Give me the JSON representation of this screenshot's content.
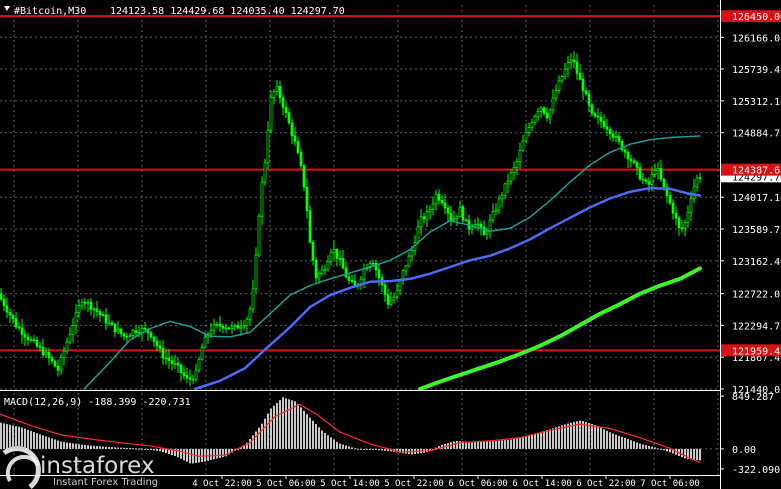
{
  "header": {
    "symbol_label": "#Bitcoin,M30",
    "ohlc_label": "124123.58 124429.68 124035.40 124297.70"
  },
  "colors": {
    "background": "#000000",
    "grid": "#5a5f66",
    "candle": "#00ff00",
    "ma_fast": "#1a9e96",
    "ma_mid": "#4a6cf7",
    "ma_slow": "#3df52a",
    "level_line": "#e01010",
    "level_badge": "#d41414",
    "macd_bars": "#c8c8c8",
    "macd_signal": "#ff2a2a",
    "axis_text": "#ffffff",
    "price_tag_bg": "#ffffff"
  },
  "watermark": {
    "brand": "instaforex",
    "tagline": "Instant Forex Trading"
  },
  "chart_data": [
    {
      "type": "candlestick",
      "timeframe": "M30",
      "ylim": [
        121440.05,
        126600.0
      ],
      "y_ticks": [
        126166.08,
        125739.45,
        125312.1,
        124884.75,
        124017.1,
        123589.75,
        123162.4,
        122722.05,
        122294.75,
        121867.4,
        121440.05
      ],
      "x_ticks": [
        "4 Oct 22:00",
        "5 Oct 06:00",
        "5 Oct 14:00",
        "5 Oct 22:00",
        "6 Oct 06:00",
        "6 Oct 14:00",
        "6 Oct 22:00",
        "7 Oct 06:00"
      ],
      "last_price_tag": 124297.7,
      "horizontal_levels": [
        {
          "value": 126450.0,
          "label": "126450.00"
        },
        {
          "value": 124387.68,
          "label": "124387.68"
        },
        {
          "value": 121959.45,
          "label": "121959.45"
        }
      ],
      "price_path": [
        [
          0,
          122720
        ],
        [
          18,
          122300
        ],
        [
          32,
          122100
        ],
        [
          48,
          121900
        ],
        [
          60,
          121700
        ],
        [
          72,
          122200
        ],
        [
          84,
          122650
        ],
        [
          98,
          122500
        ],
        [
          112,
          122300
        ],
        [
          126,
          122150
        ],
        [
          140,
          122250
        ],
        [
          152,
          122200
        ],
        [
          164,
          121900
        ],
        [
          178,
          121750
        ],
        [
          190,
          121550
        ],
        [
          198,
          121650
        ],
        [
          204,
          122000
        ],
        [
          212,
          122250
        ],
        [
          224,
          122300
        ],
        [
          236,
          122250
        ],
        [
          248,
          122350
        ],
        [
          254,
          122600
        ],
        [
          258,
          123200
        ],
        [
          262,
          124000
        ],
        [
          268,
          124600
        ],
        [
          272,
          125300
        ],
        [
          278,
          125500
        ],
        [
          284,
          125300
        ],
        [
          290,
          125050
        ],
        [
          298,
          124700
        ],
        [
          304,
          124350
        ],
        [
          308,
          124000
        ],
        [
          312,
          123400
        ],
        [
          318,
          122950
        ],
        [
          326,
          123050
        ],
        [
          334,
          123350
        ],
        [
          342,
          123150
        ],
        [
          350,
          122900
        ],
        [
          358,
          122800
        ],
        [
          366,
          123050
        ],
        [
          374,
          123200
        ],
        [
          382,
          122900
        ],
        [
          390,
          122600
        ],
        [
          398,
          122700
        ],
        [
          406,
          123050
        ],
        [
          414,
          123300
        ],
        [
          422,
          123700
        ],
        [
          430,
          123800
        ],
        [
          438,
          124050
        ],
        [
          446,
          123950
        ],
        [
          454,
          123700
        ],
        [
          462,
          123850
        ],
        [
          470,
          123600
        ],
        [
          478,
          123700
        ],
        [
          486,
          123500
        ],
        [
          494,
          123750
        ],
        [
          502,
          124000
        ],
        [
          510,
          124250
        ],
        [
          518,
          124450
        ],
        [
          526,
          124800
        ],
        [
          534,
          125050
        ],
        [
          542,
          125250
        ],
        [
          550,
          125100
        ],
        [
          558,
          125450
        ],
        [
          566,
          125700
        ],
        [
          574,
          125900
        ],
        [
          580,
          125650
        ],
        [
          586,
          125450
        ],
        [
          594,
          125100
        ],
        [
          602,
          125050
        ],
        [
          610,
          124950
        ],
        [
          618,
          124800
        ],
        [
          626,
          124650
        ],
        [
          634,
          124500
        ],
        [
          642,
          124300
        ],
        [
          650,
          124150
        ],
        [
          658,
          124450
        ],
        [
          664,
          124200
        ],
        [
          670,
          124000
        ],
        [
          676,
          123800
        ],
        [
          682,
          123550
        ],
        [
          688,
          123700
        ],
        [
          694,
          124100
        ],
        [
          700,
          124300
        ]
      ],
      "ma_fast": [
        [
          84,
          121440
        ],
        [
          110,
          121800
        ],
        [
          130,
          122100
        ],
        [
          150,
          122250
        ],
        [
          170,
          122350
        ],
        [
          190,
          122280
        ],
        [
          210,
          122150
        ],
        [
          230,
          122140
        ],
        [
          250,
          122200
        ],
        [
          270,
          122450
        ],
        [
          290,
          122700
        ],
        [
          310,
          122830
        ],
        [
          330,
          122920
        ],
        [
          350,
          123000
        ],
        [
          370,
          123080
        ],
        [
          390,
          123170
        ],
        [
          410,
          123310
        ],
        [
          430,
          123550
        ],
        [
          450,
          123700
        ],
        [
          470,
          123640
        ],
        [
          490,
          123560
        ],
        [
          510,
          123600
        ],
        [
          530,
          123750
        ],
        [
          550,
          123970
        ],
        [
          570,
          124220
        ],
        [
          590,
          124450
        ],
        [
          610,
          124620
        ],
        [
          630,
          124730
        ],
        [
          650,
          124790
        ],
        [
          670,
          124820
        ],
        [
          700,
          124840
        ]
      ],
      "ma_mid": [
        [
          195,
          121440
        ],
        [
          220,
          121550
        ],
        [
          245,
          121720
        ],
        [
          265,
          121970
        ],
        [
          290,
          122270
        ],
        [
          310,
          122540
        ],
        [
          330,
          122700
        ],
        [
          350,
          122800
        ],
        [
          370,
          122880
        ],
        [
          390,
          122890
        ],
        [
          410,
          122920
        ],
        [
          430,
          122990
        ],
        [
          450,
          123080
        ],
        [
          470,
          123170
        ],
        [
          490,
          123230
        ],
        [
          510,
          123330
        ],
        [
          530,
          123450
        ],
        [
          550,
          123600
        ],
        [
          570,
          123740
        ],
        [
          590,
          123880
        ],
        [
          610,
          124000
        ],
        [
          630,
          124090
        ],
        [
          650,
          124140
        ],
        [
          670,
          124130
        ],
        [
          690,
          124060
        ],
        [
          700,
          124040
        ]
      ],
      "ma_slow": [
        [
          420,
          121440
        ],
        [
          440,
          121540
        ],
        [
          460,
          121630
        ],
        [
          480,
          121720
        ],
        [
          500,
          121810
        ],
        [
          520,
          121910
        ],
        [
          540,
          122020
        ],
        [
          560,
          122150
        ],
        [
          580,
          122300
        ],
        [
          600,
          122450
        ],
        [
          620,
          122580
        ],
        [
          640,
          122720
        ],
        [
          660,
          122830
        ],
        [
          680,
          122920
        ],
        [
          700,
          123060
        ]
      ]
    },
    {
      "type": "macd",
      "title": "MACD(12,26,9)",
      "macd_value": -188.399,
      "signal_value": -220.731,
      "ylim": [
        -420,
        900
      ],
      "y_ticks": [
        849.287,
        0.0,
        -322.09
      ],
      "histogram_path": [
        [
          0,
          420
        ],
        [
          20,
          350
        ],
        [
          40,
          230
        ],
        [
          60,
          120
        ],
        [
          80,
          70
        ],
        [
          100,
          40
        ],
        [
          120,
          20
        ],
        [
          140,
          5
        ],
        [
          160,
          -40
        ],
        [
          175,
          -120
        ],
        [
          190,
          -240
        ],
        [
          205,
          -200
        ],
        [
          225,
          -120
        ],
        [
          245,
          80
        ],
        [
          260,
          380
        ],
        [
          270,
          650
        ],
        [
          282,
          830
        ],
        [
          295,
          760
        ],
        [
          308,
          520
        ],
        [
          322,
          280
        ],
        [
          338,
          90
        ],
        [
          355,
          5
        ],
        [
          372,
          -10
        ],
        [
          390,
          -40
        ],
        [
          410,
          -90
        ],
        [
          425,
          -60
        ],
        [
          440,
          60
        ],
        [
          455,
          130
        ],
        [
          470,
          110
        ],
        [
          490,
          120
        ],
        [
          510,
          150
        ],
        [
          530,
          230
        ],
        [
          550,
          320
        ],
        [
          565,
          400
        ],
        [
          580,
          460
        ],
        [
          595,
          380
        ],
        [
          610,
          260
        ],
        [
          625,
          170
        ],
        [
          640,
          80
        ],
        [
          655,
          20
        ],
        [
          670,
          -60
        ],
        [
          685,
          -160
        ],
        [
          700,
          -188
        ]
      ],
      "signal_path": [
        [
          0,
          560
        ],
        [
          30,
          380
        ],
        [
          60,
          230
        ],
        [
          90,
          160
        ],
        [
          120,
          100
        ],
        [
          150,
          50
        ],
        [
          180,
          -40
        ],
        [
          200,
          -120
        ],
        [
          225,
          -100
        ],
        [
          250,
          100
        ],
        [
          275,
          520
        ],
        [
          300,
          720
        ],
        [
          318,
          540
        ],
        [
          340,
          270
        ],
        [
          370,
          80
        ],
        [
          400,
          -50
        ],
        [
          430,
          -30
        ],
        [
          460,
          100
        ],
        [
          490,
          130
        ],
        [
          520,
          180
        ],
        [
          550,
          300
        ],
        [
          580,
          400
        ],
        [
          610,
          330
        ],
        [
          640,
          180
        ],
        [
          670,
          10
        ],
        [
          690,
          -150
        ],
        [
          700,
          -220
        ]
      ]
    }
  ]
}
